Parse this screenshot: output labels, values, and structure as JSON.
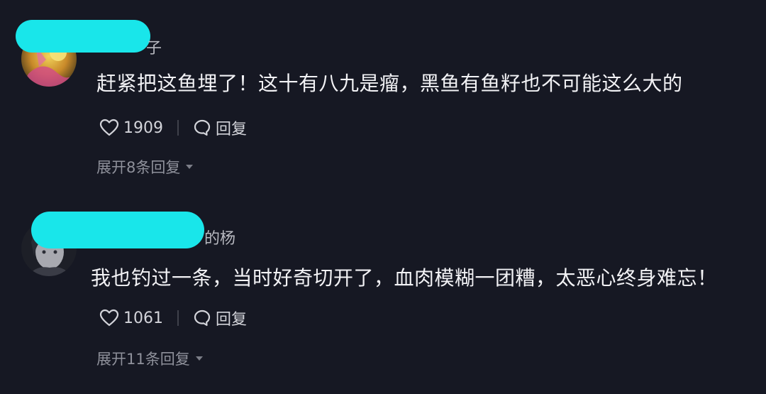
{
  "comments": [
    {
      "username_tail": "子",
      "text": "赶紧把这鱼埋了！这十有八九是瘤，黑鱼有鱼籽也不可能这么大的",
      "like_count": "1909",
      "reply_label": "回复",
      "expand_label": "展开8条回复"
    },
    {
      "username_tail": "的杨",
      "text": "我也钓过一条，当时好奇切开了，血肉模糊一团糟，太恶心终身难忘！",
      "like_count": "1061",
      "reply_label": "回复",
      "expand_label": "展开11条回复"
    }
  ],
  "colors": {
    "background": "#161823",
    "redaction": "#19e6ea"
  },
  "icons": {
    "like": "heart-outline-icon",
    "reply": "speech-bubble-icon",
    "expand": "caret-down-icon"
  }
}
